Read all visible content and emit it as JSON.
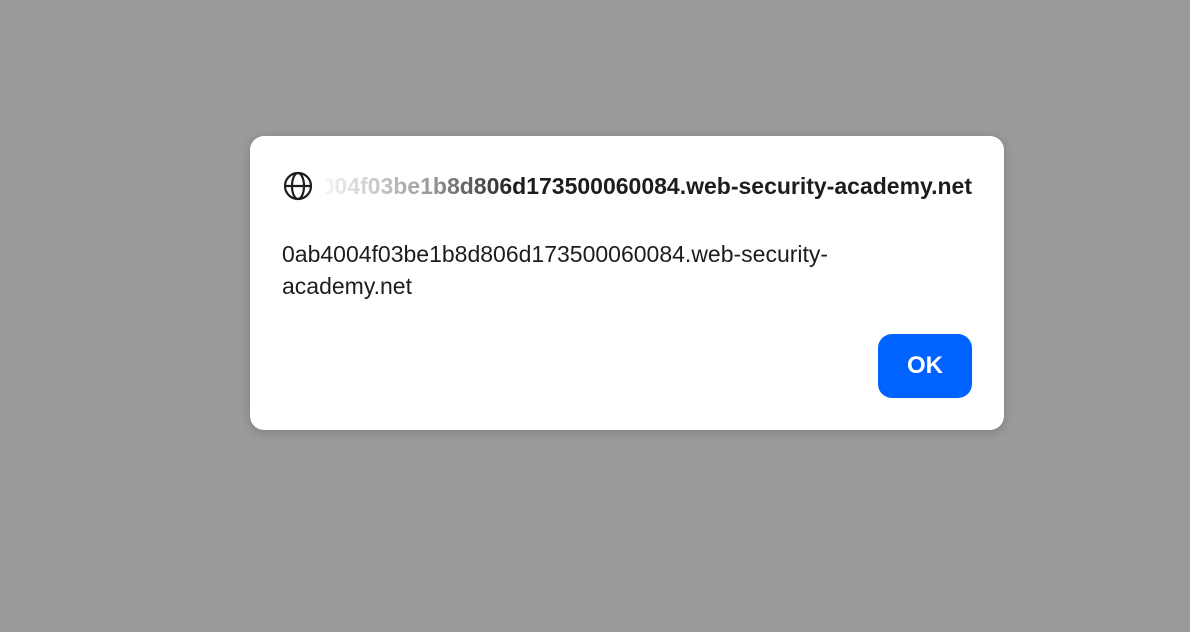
{
  "dialog": {
    "origin": "0ab4004f03be1b8d806d173500060084.web-security-academy.net",
    "message_line1": "0ab4004f03be1b8d806d173500060084.web-security-",
    "message_line2": "academy.net",
    "ok_label": "OK",
    "icon": "globe-icon"
  },
  "colors": {
    "backdrop": "#9a9a9c",
    "dialog_bg": "#ffffff",
    "button_bg": "#0062ff",
    "text": "#1d1d1f"
  }
}
